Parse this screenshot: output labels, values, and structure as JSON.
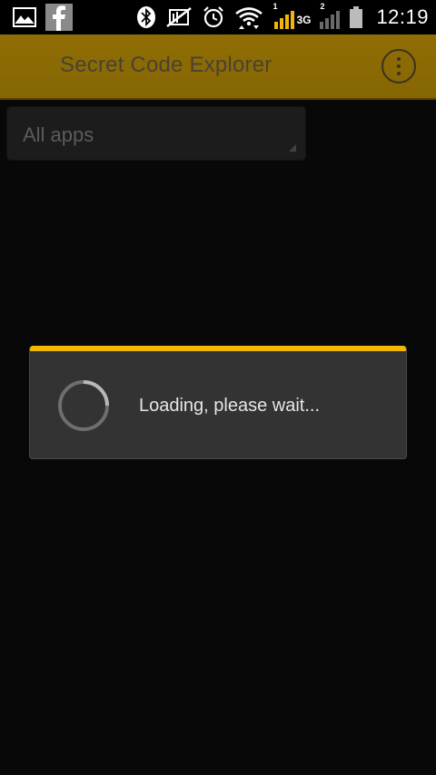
{
  "status_bar": {
    "time": "12:19",
    "network_type": "3G",
    "sim1_label": "1",
    "sim2_label": "2",
    "icons_left": [
      "gallery-icon",
      "facebook-icon"
    ],
    "icons_right": [
      "bluetooth-icon",
      "mute-icon",
      "alarm-icon",
      "wifi-icon",
      "signal-sim1-icon",
      "signal-sim2-icon",
      "battery-icon"
    ]
  },
  "action_bar": {
    "title": "Secret Code Explorer",
    "menu_icon": "overflow-menu-icon"
  },
  "filter": {
    "selected": "All apps"
  },
  "dialog": {
    "message": "Loading, please wait...",
    "accent_color": "#f2b705"
  },
  "colors": {
    "action_bar": "#8a6a04",
    "background": "#0b0b0b",
    "dialog": "#333333"
  }
}
